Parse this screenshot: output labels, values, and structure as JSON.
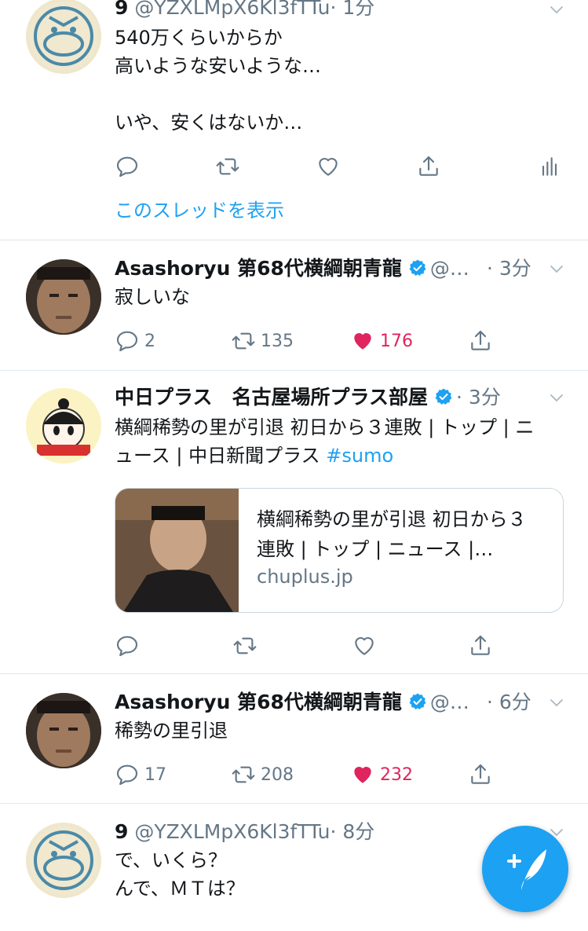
{
  "colors": {
    "accent": "#1da1f2",
    "like": "#e0245e",
    "secondary": "#657786",
    "border": "#e1e8ed"
  },
  "tweets": [
    {
      "name": "9",
      "handle": "@YZXLMpX6Kl3fTTu",
      "time": "· 1分",
      "text": "540万くらいからか\n高いような安いような…\n\nいや、安くはないか…",
      "thread_link": "このスレッドを表示",
      "avatar_icon": "bird-stamp-avatar",
      "actions": {
        "reply": "",
        "retweet": "",
        "like": "",
        "share": "",
        "analytics": "analytics-icon"
      }
    },
    {
      "name": "Asashoryu 第68代横綱朝青龍",
      "handle": "@…",
      "time": "· 3分",
      "verified": true,
      "text": "寂しいな",
      "actions": {
        "reply": "2",
        "retweet": "135",
        "like": "176"
      }
    },
    {
      "name": "中日プラス　名古屋場所プラス部屋",
      "time": "· 3分",
      "verified": true,
      "text": "横綱稀勢の里が引退 初日から３連敗 | トップ | ニュース | 中日新聞プラス ",
      "hashtag": "#sumo",
      "card": {
        "title": "横綱稀勢の里が引退 初日から３連敗 | トップ | ニュース |…",
        "domain": "chuplus.jp"
      },
      "actions": {
        "reply": "",
        "retweet": "",
        "like": "",
        "share": ""
      }
    },
    {
      "name": "Asashoryu 第68代横綱朝青龍",
      "handle": "@…",
      "time": "· 6分",
      "verified": true,
      "text": "稀勢の里引退",
      "actions": {
        "reply": "17",
        "retweet": "208",
        "like": "232"
      }
    },
    {
      "name": "9",
      "handle": "@YZXLMpX6Kl3fTTu",
      "time": "· 8分",
      "text": "で、いくら？\nんで、ＭＴは？"
    }
  ],
  "fab_icon": "compose-tweet-icon"
}
